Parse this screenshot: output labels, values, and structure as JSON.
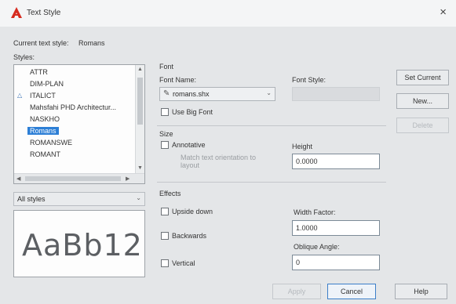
{
  "window": {
    "title": "Text Style",
    "close_label": "×"
  },
  "current_style": {
    "label": "Current text style:",
    "value": "Romans"
  },
  "styles": {
    "label": "Styles:",
    "items": [
      {
        "label": "ATTR",
        "selected": false,
        "annotative": false
      },
      {
        "label": "DIM-PLAN",
        "selected": false,
        "annotative": false
      },
      {
        "label": "ITALICT",
        "selected": false,
        "annotative": true
      },
      {
        "label": "Mahsfahi PHD Architectur...",
        "selected": false,
        "annotative": false
      },
      {
        "label": "NASKHO",
        "selected": false,
        "annotative": false
      },
      {
        "label": "Romans",
        "selected": true,
        "annotative": false
      },
      {
        "label": "ROMANSWE",
        "selected": false,
        "annotative": false
      },
      {
        "label": "ROMANT",
        "selected": false,
        "annotative": false
      }
    ],
    "filter_value": "All styles",
    "preview_text": "AaBb12"
  },
  "font": {
    "group_label": "Font",
    "name_label": "Font Name:",
    "name_value": "romans.shx",
    "style_label": "Font Style:",
    "style_value": "",
    "big_font_label": "Use Big Font",
    "big_font_checked": false
  },
  "size": {
    "group_label": "Size",
    "annotative_label": "Annotative",
    "annotative_checked": false,
    "match_orientation_label": "Match text orientation to layout",
    "height_label": "Height",
    "height_value": "0.0000"
  },
  "effects": {
    "group_label": "Effects",
    "upside_down_label": "Upside down",
    "backwards_label": "Backwards",
    "vertical_label": "Vertical",
    "width_factor_label": "Width Factor:",
    "width_factor_value": "1.0000",
    "oblique_angle_label": "Oblique Angle:",
    "oblique_angle_value": "0"
  },
  "buttons": {
    "set_current": "Set Current",
    "new": "New...",
    "delete": "Delete",
    "apply": "Apply",
    "cancel": "Cancel",
    "help": "Help"
  },
  "colors": {
    "title_icon": "#d62b1f",
    "selection": "#2d7fd6",
    "primary_border": "#3c7fc9"
  }
}
